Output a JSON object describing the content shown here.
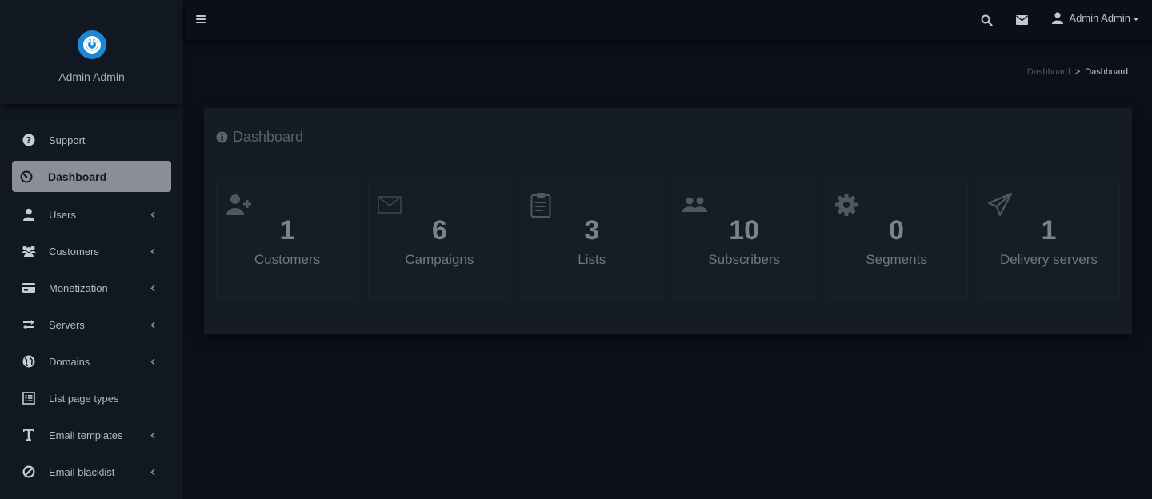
{
  "brand": {
    "name": "Admin Admin",
    "logo_color": "#1d87d4"
  },
  "sidebar": {
    "items": [
      {
        "label": "Support",
        "icon": "question-circle-icon",
        "has_submenu": false,
        "active": false
      },
      {
        "label": "Dashboard",
        "icon": "dashboard-gauge-icon",
        "has_submenu": false,
        "active": true
      },
      {
        "label": "Users",
        "icon": "user-icon",
        "has_submenu": true,
        "active": false
      },
      {
        "label": "Customers",
        "icon": "users-group-icon",
        "has_submenu": true,
        "active": false
      },
      {
        "label": "Monetization",
        "icon": "credit-card-icon",
        "has_submenu": true,
        "active": false
      },
      {
        "label": "Servers",
        "icon": "transfer-arrows-icon",
        "has_submenu": true,
        "active": false
      },
      {
        "label": "Domains",
        "icon": "globe-icon",
        "has_submenu": true,
        "active": false
      },
      {
        "label": "List page types",
        "icon": "list-alt-icon",
        "has_submenu": false,
        "active": false
      },
      {
        "label": "Email templates",
        "icon": "text-t-icon",
        "has_submenu": true,
        "active": false
      },
      {
        "label": "Email blacklist",
        "icon": "ban-icon",
        "has_submenu": true,
        "active": false
      }
    ]
  },
  "topbar": {
    "user_name": "Admin Admin"
  },
  "breadcrumb": {
    "parent": "Dashboard",
    "separator": ">",
    "current": "Dashboard"
  },
  "panel": {
    "title": "Dashboard",
    "stats": [
      {
        "value": "1",
        "label": "Customers",
        "icon": "user-plus-icon"
      },
      {
        "value": "6",
        "label": "Campaigns",
        "icon": "envelope-icon"
      },
      {
        "value": "3",
        "label": "Lists",
        "icon": "clipboard-icon"
      },
      {
        "value": "10",
        "label": "Subscribers",
        "icon": "users-icon"
      },
      {
        "value": "0",
        "label": "Segments",
        "icon": "cog-icon"
      },
      {
        "value": "1",
        "label": "Delivery servers",
        "icon": "paper-plane-icon"
      }
    ]
  },
  "colors": {
    "background": "#0c1119",
    "sidebar": "#111821",
    "active_item": "#8a8f96",
    "panel": "#151c25"
  }
}
